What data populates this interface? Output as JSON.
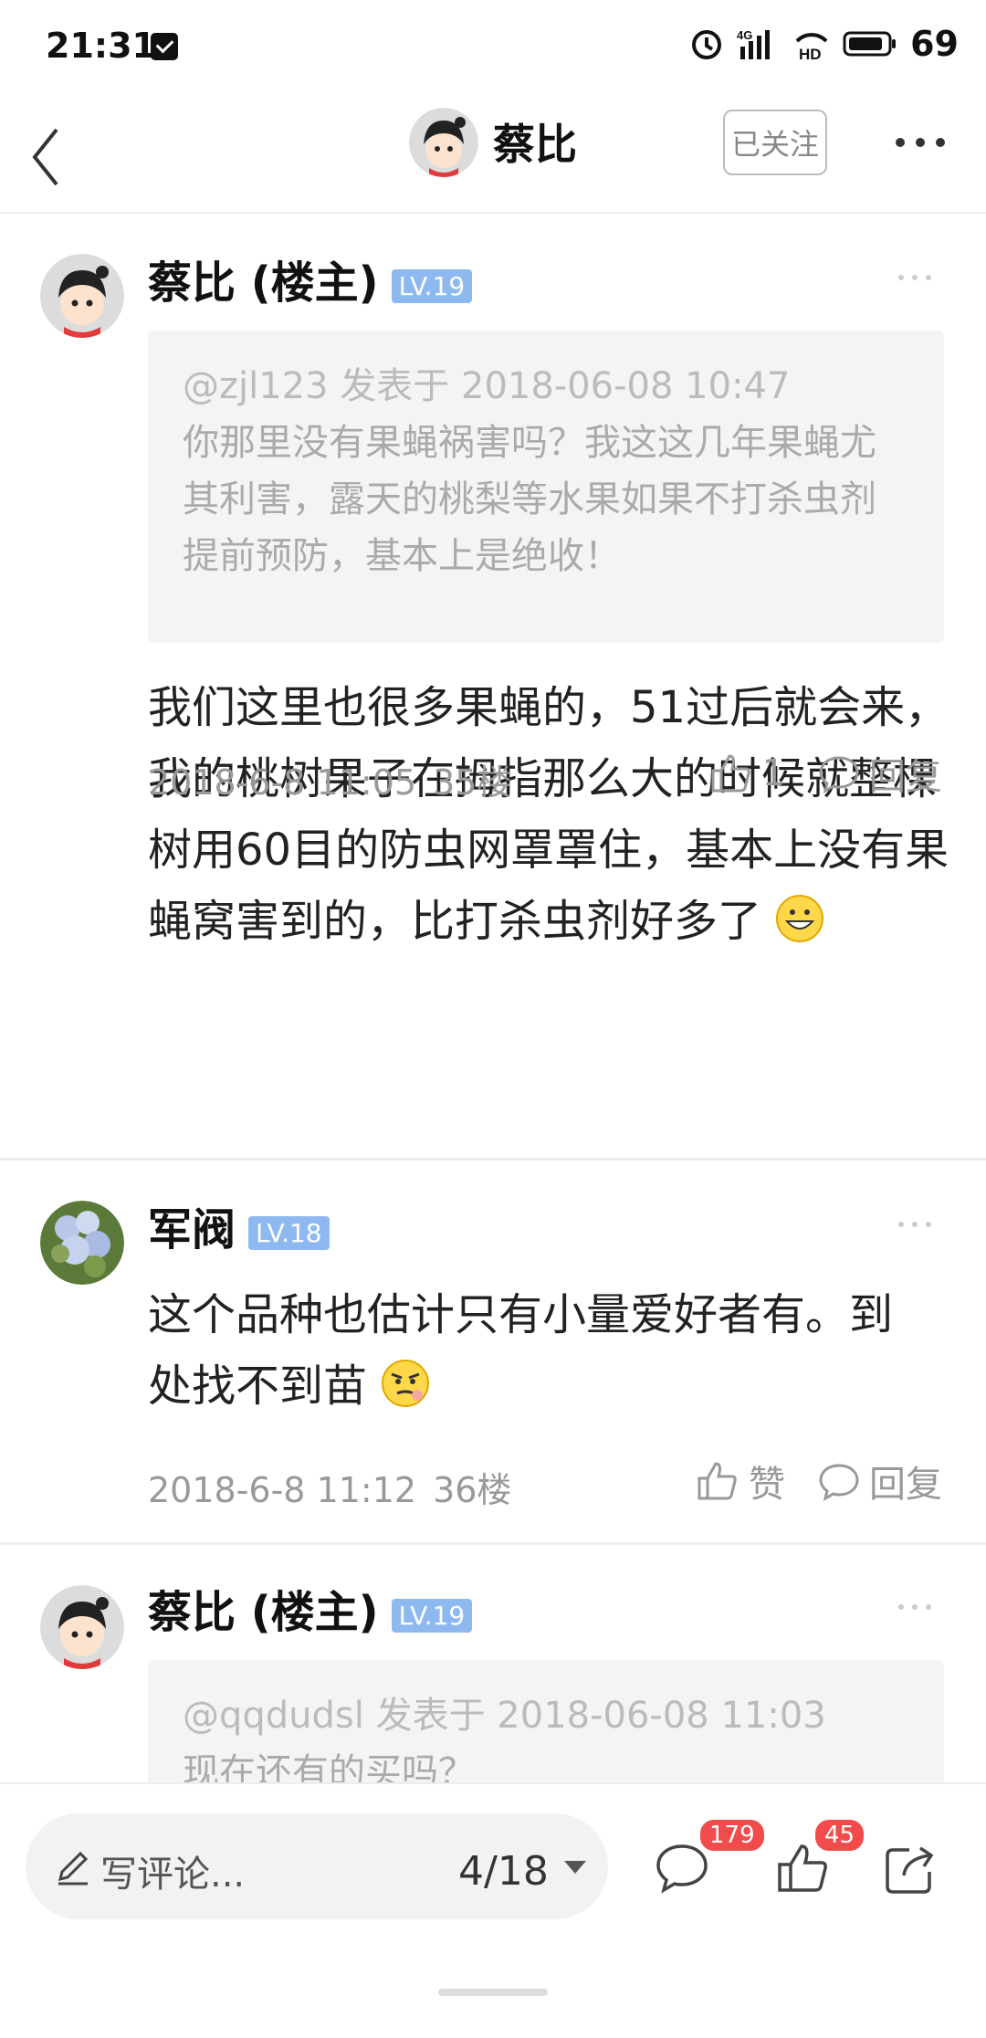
{
  "status": {
    "time": "21:31",
    "battery": "69",
    "network": "4G",
    "hd": "HD"
  },
  "nav": {
    "title": "蔡比",
    "follow_label": "已关注"
  },
  "posts": [
    {
      "username": "蔡比 (楼主)",
      "level": "LV.19",
      "quote": {
        "header": "@zjl123 发表于 2018-06-08 10:47",
        "text": "你那里没有果蝇祸害吗？我这这几年果蝇尤其利害，露天的桃梨等水果如果不打杀虫剂提前预防，基本上是绝收！"
      },
      "body": "我们这里也很多果蝇的，51过后就会来，我的桃树果子在拇指那么大的时候就整棵树用60目的防虫网罩罩住，基本上没有果蝇窝害到的，比打杀虫剂好多了",
      "time": "2018-6-8 11:05",
      "floor": "35楼",
      "like_label": "1",
      "reply_label": "回复"
    },
    {
      "username": "军阀",
      "level": "LV.18",
      "body": "这个品种也估计只有小量爱好者有。到处找不到苗",
      "time": "2018-6-8 11:12",
      "floor": "36楼",
      "like_label": "赞",
      "reply_label": "回复"
    },
    {
      "username": "蔡比 (楼主)",
      "level": "LV.19",
      "quote": {
        "header": "@qqdudsl 发表于 2018-06-08 11:03",
        "text": "现在还有的买吗？"
      }
    }
  ],
  "bottom": {
    "comment_placeholder": "写评论...",
    "page": "4/18",
    "comment_count": "179",
    "like_count": "45"
  },
  "colors": {
    "level_badge": "#8eb8f0",
    "badge_red": "#f24b4b",
    "quote_bg": "#f4f4f4"
  }
}
